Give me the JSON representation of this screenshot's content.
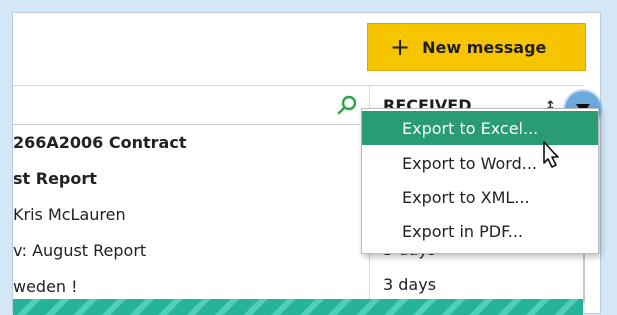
{
  "toolbar": {
    "new_message_label": "New message",
    "plus_symbol": "+"
  },
  "columns": {
    "received_title": "RECEIVED",
    "sort_symbol": "↕"
  },
  "rows": [
    {
      "subject": "266A2006 Contract",
      "bold": true,
      "received": ""
    },
    {
      "subject": "st Report",
      "bold": true,
      "received": ""
    },
    {
      "subject": "Kris McLauren",
      "bold": false,
      "received": ""
    },
    {
      "subject": "v: August Report",
      "bold": false,
      "received": "3 days"
    },
    {
      "subject": "weden !",
      "bold": false,
      "received": "3 days"
    }
  ],
  "menu": {
    "items": [
      {
        "label": "Export to Excel...",
        "active": true
      },
      {
        "label": "Export to Word...",
        "active": false
      },
      {
        "label": "Export to XML...",
        "active": false
      },
      {
        "label": "Export in PDF...",
        "active": false
      }
    ]
  },
  "colors": {
    "accent": "#f7c400",
    "menu_active": "#2a9c73",
    "background": "#d4e7f5"
  }
}
